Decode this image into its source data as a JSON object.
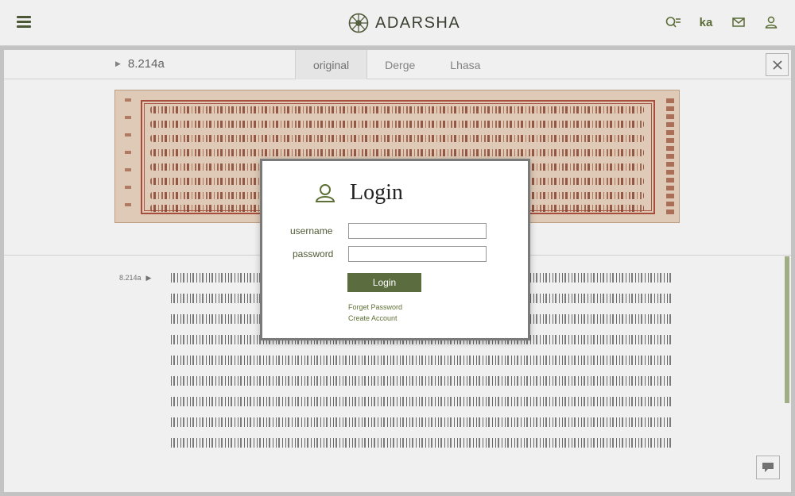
{
  "header": {
    "brand": "ADARSHA",
    "lang_label": "ka",
    "icons": [
      "menu-icon",
      "dharma-wheel-logo",
      "search-list-icon",
      "mail-icon",
      "user-icon"
    ],
    "accent_color": "#5d7035"
  },
  "viewer": {
    "folio": "8.214a",
    "tabs": [
      {
        "label": "original",
        "active": true
      },
      {
        "label": "Derge",
        "active": false
      },
      {
        "label": "Lhasa",
        "active": false
      }
    ],
    "text_folio": "8.214a"
  },
  "login": {
    "title": "Login",
    "username_label": "username",
    "password_label": "password",
    "username_value": "",
    "password_value": "",
    "button_label": "Login",
    "forget_password": "Forget Password",
    "create_account": "Create Account"
  }
}
